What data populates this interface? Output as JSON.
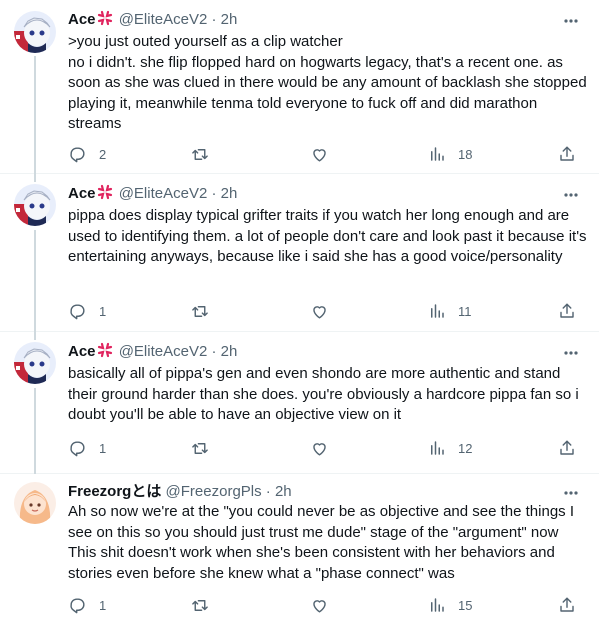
{
  "tweets": [
    {
      "name": "Ace",
      "has_emoji": true,
      "handle": "@EliteAceV2",
      "sep": "·",
      "time": "2h",
      "text": ">you just outed yourself as a clip watcher\nno i didn't. she flip flopped hard on hogwarts legacy, that's a recent one. as soon as she was clued in there would be any amount of backlash she stopped playing it, meanwhile tenma told everyone to fuck off and did marathon streams",
      "replies": "2",
      "retweets": "",
      "likes": "",
      "views": "18"
    },
    {
      "name": "Ace",
      "has_emoji": true,
      "handle": "@EliteAceV2",
      "sep": "·",
      "time": "2h",
      "text": "pippa does display typical grifter traits if you watch her long enough and are used to identifying them. a lot of people don't care and look past it because it's entertaining anyways, because like i said she has a good voice/personality",
      "replies": "1",
      "retweets": "",
      "likes": "",
      "views": "11"
    },
    {
      "name": "Ace",
      "has_emoji": true,
      "handle": "@EliteAceV2",
      "sep": "·",
      "time": "2h",
      "text": "basically all of pippa's gen and even shondo are more authentic and stand their ground harder than she does. you're obviously a hardcore pippa fan so i doubt you'll be able to have an objective view on it",
      "replies": "1",
      "retweets": "",
      "likes": "",
      "views": "12"
    },
    {
      "name": "Freezorgとは",
      "has_emoji": false,
      "handle": "@FreezorgPls",
      "sep": "·",
      "time": "2h",
      "text": "Ah so now we're at the \"you could never be as objective and see the things I see on this so you should just trust me dude\" stage of the \"argument\" now This shit doesn't work when she's been consistent with her behaviors and stories even before she knew what a \"phase connect\" was",
      "replies": "1",
      "retweets": "",
      "likes": "",
      "views": "15"
    }
  ],
  "colors": {
    "text": "#0f1419",
    "muted": "#536471",
    "border": "#eff3f4",
    "anger_emoji": "#e0245e"
  },
  "icons": [
    "reply-icon",
    "retweet-icon",
    "like-icon",
    "views-icon",
    "share-icon",
    "more-icon",
    "anger-emoji-icon"
  ]
}
